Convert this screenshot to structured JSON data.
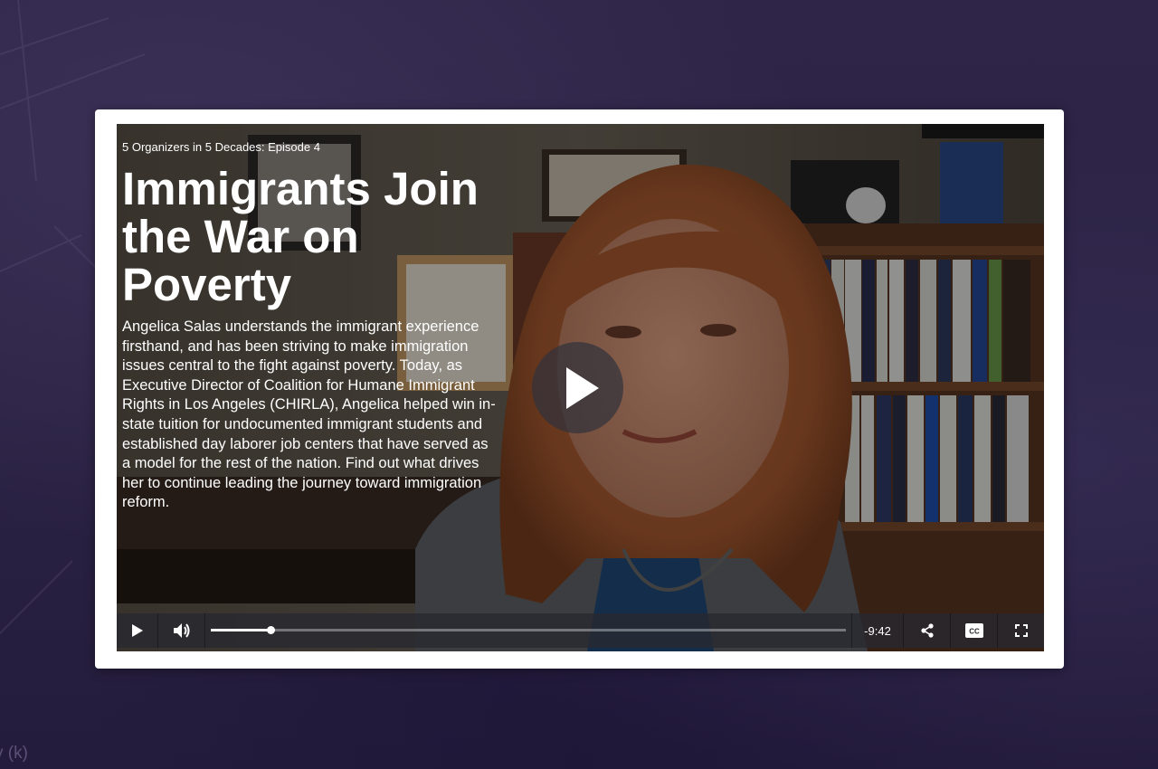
{
  "page": {
    "corner_label": "y (k)"
  },
  "video": {
    "episode_label": "5 Organizers in 5 Decades: Episode 4",
    "title": "Immigrants Join the War on Poverty",
    "description": "Angelica Salas understands the immigrant experience firsthand, and has been striving to make immigration issues central to the fight against poverty. Today, as Executive Director of Coalition for Humane Immigrant Rights in Los Angeles (CHIRLA), Angelica helped win in-state tuition for undocumented immigrant students and established day laborer job centers that have served as a model for the rest of the nation. Find out what drives her to continue leading the journey toward immigration reform.",
    "big_play_icon": "play-icon"
  },
  "controls": {
    "play_icon": "play-icon",
    "volume_icon": "volume-icon",
    "progress_fraction": 0.094,
    "time_remaining": "-9:42",
    "share_icon": "share-icon",
    "cc_icon": "closed-captions-icon",
    "cc_label": "CC",
    "fullscreen_icon": "fullscreen-icon"
  }
}
